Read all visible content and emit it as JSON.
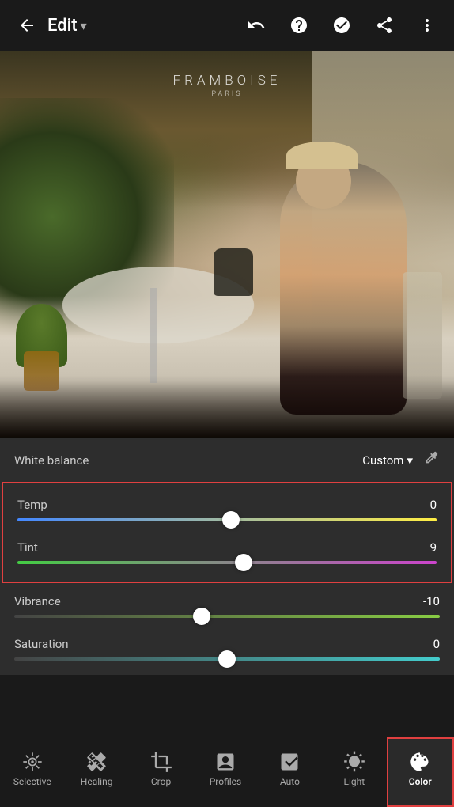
{
  "header": {
    "back_label": "←",
    "title": "Edit",
    "dropdown_arrow": "▾",
    "undo_label": "↩",
    "help_label": "?",
    "check_label": "✓",
    "share_label": "⬆",
    "more_label": "⋮"
  },
  "photo": {
    "brand_text": "FRAMBOISE",
    "brand_sub": "PARIS"
  },
  "controls": {
    "white_balance_label": "White balance",
    "white_balance_value": "Custom",
    "dropdown_arrow": "▾",
    "sliders": [
      {
        "id": "temp",
        "label": "Temp",
        "value": "0",
        "thumb_pct": 51,
        "track_class": "temp-track",
        "highlighted": true
      },
      {
        "id": "tint",
        "label": "Tint",
        "value": "9",
        "thumb_pct": 54,
        "track_class": "tint-track",
        "highlighted": true
      },
      {
        "id": "vibrance",
        "label": "Vibrance",
        "value": "-10",
        "thumb_pct": 44,
        "track_class": "vibrance-track",
        "highlighted": false
      },
      {
        "id": "saturation",
        "label": "Saturation",
        "value": "0",
        "thumb_pct": 50,
        "track_class": "saturation-track",
        "highlighted": false
      }
    ]
  },
  "nav": {
    "items": [
      {
        "id": "selective",
        "label": "Selective",
        "active": false
      },
      {
        "id": "healing",
        "label": "Healing",
        "active": false
      },
      {
        "id": "crop",
        "label": "Crop",
        "active": false
      },
      {
        "id": "profiles",
        "label": "Profiles",
        "active": false
      },
      {
        "id": "auto",
        "label": "Auto",
        "active": false
      },
      {
        "id": "light",
        "label": "Light",
        "active": false
      },
      {
        "id": "color",
        "label": "Color",
        "active": true
      }
    ]
  }
}
